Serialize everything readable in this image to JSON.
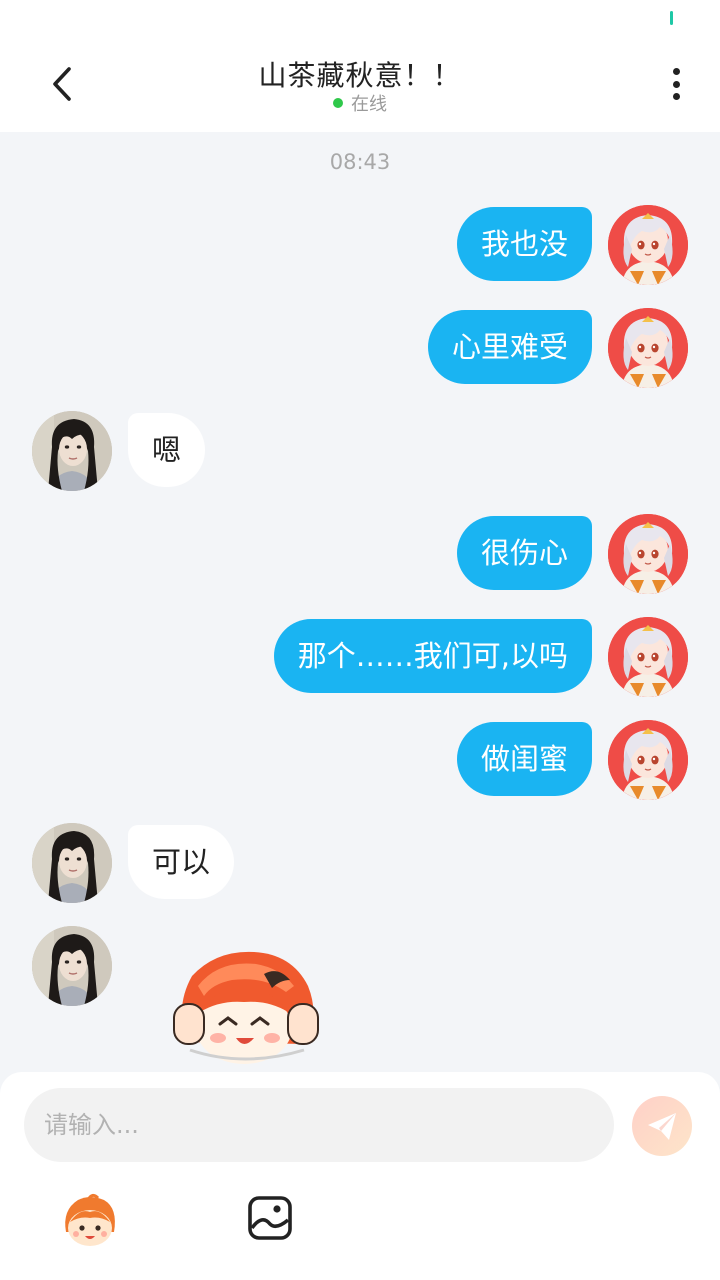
{
  "header": {
    "title": "山茶藏秋意！！",
    "status": "在线"
  },
  "chat": {
    "timestamp": "08:43",
    "messages": [
      {
        "sender": "me",
        "text": "我也没"
      },
      {
        "sender": "me",
        "text": "心里难受"
      },
      {
        "sender": "friend",
        "text": "嗯"
      },
      {
        "sender": "me",
        "text": "很伤心"
      },
      {
        "sender": "me",
        "text": "那个……我们可,以吗"
      },
      {
        "sender": "me",
        "text": "做闺蜜"
      },
      {
        "sender": "friend",
        "text": "可以"
      },
      {
        "sender": "friend",
        "sticker": "cartoon-sticker"
      }
    ]
  },
  "composer": {
    "placeholder": "请输入..."
  },
  "icons": {
    "back": "chevron-left-icon",
    "more": "more-vertical-icon",
    "send": "paper-plane-icon",
    "emoji": "emoji-sticker-icon",
    "image": "image-icon"
  },
  "colors": {
    "my_bubble": "#1ab4f2",
    "friend_bubble": "#ffffff",
    "background": "#f3f5f8",
    "online_dot": "#2fc84a"
  }
}
